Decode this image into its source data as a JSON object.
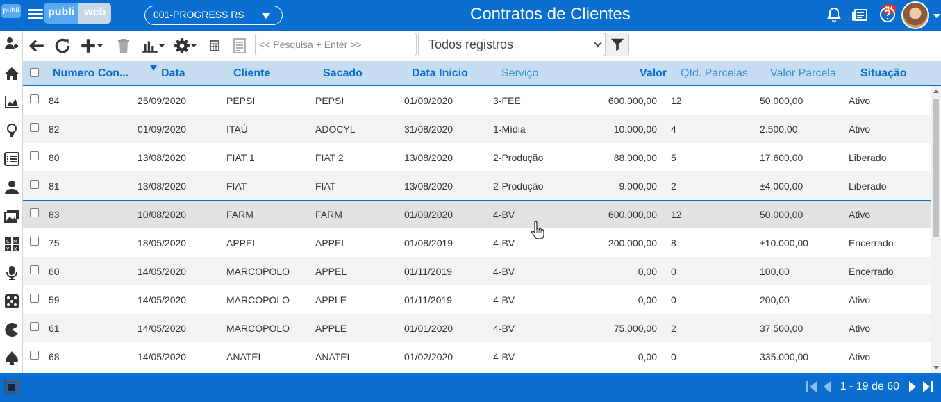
{
  "header": {
    "brand_part1": "publi",
    "brand_part2": "web",
    "company": "001-PROGRESS RS",
    "title": "Contratos de Clientes",
    "notifications_badge": "9+"
  },
  "sidebar": {
    "logo": "publi",
    "icons": [
      "add-user-icon",
      "home-icon",
      "area-chart-icon",
      "lightbulb-icon",
      "list-icon",
      "user-icon",
      "images-icon",
      "cmyk-icon",
      "microphone-icon",
      "dice-icon",
      "pacman-icon",
      "spade-icon",
      "square-icon"
    ]
  },
  "toolbar": {
    "search_placeholder": "<< Pesquisa + Enter >>",
    "filter_value": "Todos registros"
  },
  "table": {
    "columns": [
      "Numero Con...",
      "Data",
      "Cliente",
      "Sacado",
      "Data Inicio",
      "Serviço",
      "Valor",
      "Qtd. Parcelas",
      "Valor Parcela",
      "Situação"
    ],
    "rows": [
      [
        "84",
        "25/09/2020",
        "PEPSI",
        "PEPSI",
        "01/09/2020",
        "3-FEE",
        "600.000,00",
        "12",
        "50.000,00",
        "Ativo"
      ],
      [
        "82",
        "01/09/2020",
        "ITAÚ",
        "ADOCYL",
        "31/08/2020",
        "1-Mídia",
        "10.000,00",
        "4",
        "2.500,00",
        "Ativo"
      ],
      [
        "80",
        "13/08/2020",
        "FIAT 1",
        "FIAT 2",
        "13/08/2020",
        "2-Produção",
        "88.000,00",
        "5",
        "17.600,00",
        "Liberado"
      ],
      [
        "81",
        "13/08/2020",
        "FIAT",
        "FIAT",
        "13/08/2020",
        "2-Produção",
        "9.000,00",
        "2",
        "±4.000,00",
        "Liberado"
      ],
      [
        "83",
        "10/08/2020",
        "FARM",
        "FARM",
        "01/09/2020",
        "4-BV",
        "600.000,00",
        "12",
        "50.000,00",
        "Ativo"
      ],
      [
        "75",
        "18/05/2020",
        "APPEL",
        "APPEL",
        "01/08/2019",
        "4-BV",
        "200.000,00",
        "8",
        "±10.000,00",
        "Encerrado"
      ],
      [
        "60",
        "14/05/2020",
        "MARCOPOLO",
        "APPEL",
        "01/11/2019",
        "4-BV",
        "0,00",
        "0",
        "100,00",
        "Encerrado"
      ],
      [
        "59",
        "14/05/2020",
        "MARCOPOLO",
        "APPLE",
        "01/11/2019",
        "4-BV",
        "0,00",
        "0",
        "200,00",
        "Ativo"
      ],
      [
        "61",
        "14/05/2020",
        "MARCOPOLO",
        "APPLE",
        "01/01/2020",
        "4-BV",
        "75.000,00",
        "2",
        "37.500,00",
        "Ativo"
      ],
      [
        "68",
        "14/05/2020",
        "ANATEL",
        "ANATEL",
        "01/02/2020",
        "4-BV",
        "0,00",
        "0",
        "335.000,00",
        "Ativo"
      ]
    ]
  },
  "footer": {
    "pagination": "1 - 19 de 60"
  },
  "colors": {
    "primary": "#0a6ed1",
    "header_row": "#c5dcf1"
  }
}
